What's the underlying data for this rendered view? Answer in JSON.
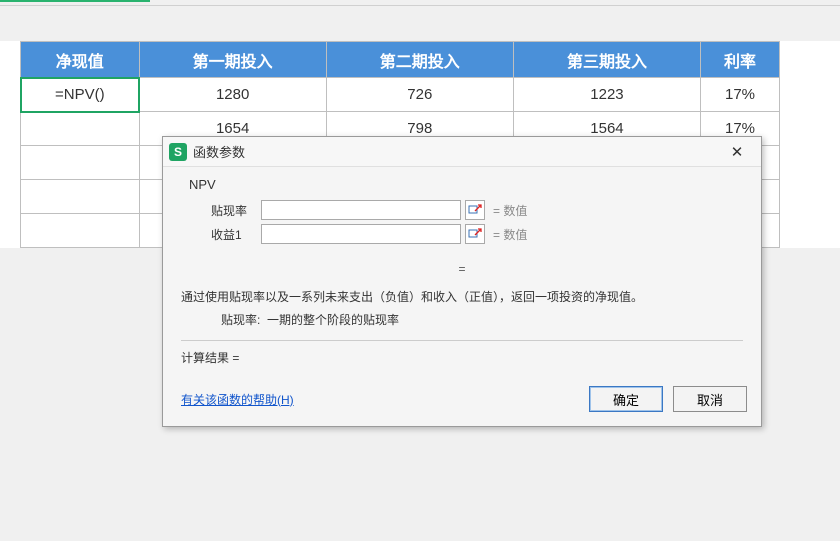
{
  "table": {
    "headers": [
      "净现值",
      "第一期投入",
      "第二期投入",
      "第三期投入",
      "利率"
    ],
    "rows": [
      {
        "c0": "=NPV()",
        "c1": "1280",
        "c2": "726",
        "c3": "1223",
        "c4": "17%"
      },
      {
        "c0": "",
        "c1": "1654",
        "c2": "798",
        "c3": "1564",
        "c4": "17%"
      },
      {
        "c0": "",
        "c1": "",
        "c2": "",
        "c3": "",
        "c4": ""
      },
      {
        "c0": "",
        "c1": "",
        "c2": "",
        "c3": "",
        "c4": ""
      },
      {
        "c0": "",
        "c1": "",
        "c2": "",
        "c3": "",
        "c4": ""
      }
    ]
  },
  "dialog": {
    "title": "函数参数",
    "logo_letter": "S",
    "func_name": "NPV",
    "params": [
      {
        "label": "贴现率",
        "value": "",
        "hint": "数值"
      },
      {
        "label": "收益1",
        "value": "",
        "hint": "数值"
      }
    ],
    "eq_symbol": "=",
    "description": "通过使用贴现率以及一系列未来支出（负值）和收入（正值），返回一项投资的净现值。",
    "sub_desc_label": "贴现率:",
    "sub_desc_text": "一期的整个阶段的贴现率",
    "result_label": "计算结果 =",
    "help_link": "有关该函数的帮助(H)",
    "ok_label": "确定",
    "cancel_label": "取消"
  }
}
